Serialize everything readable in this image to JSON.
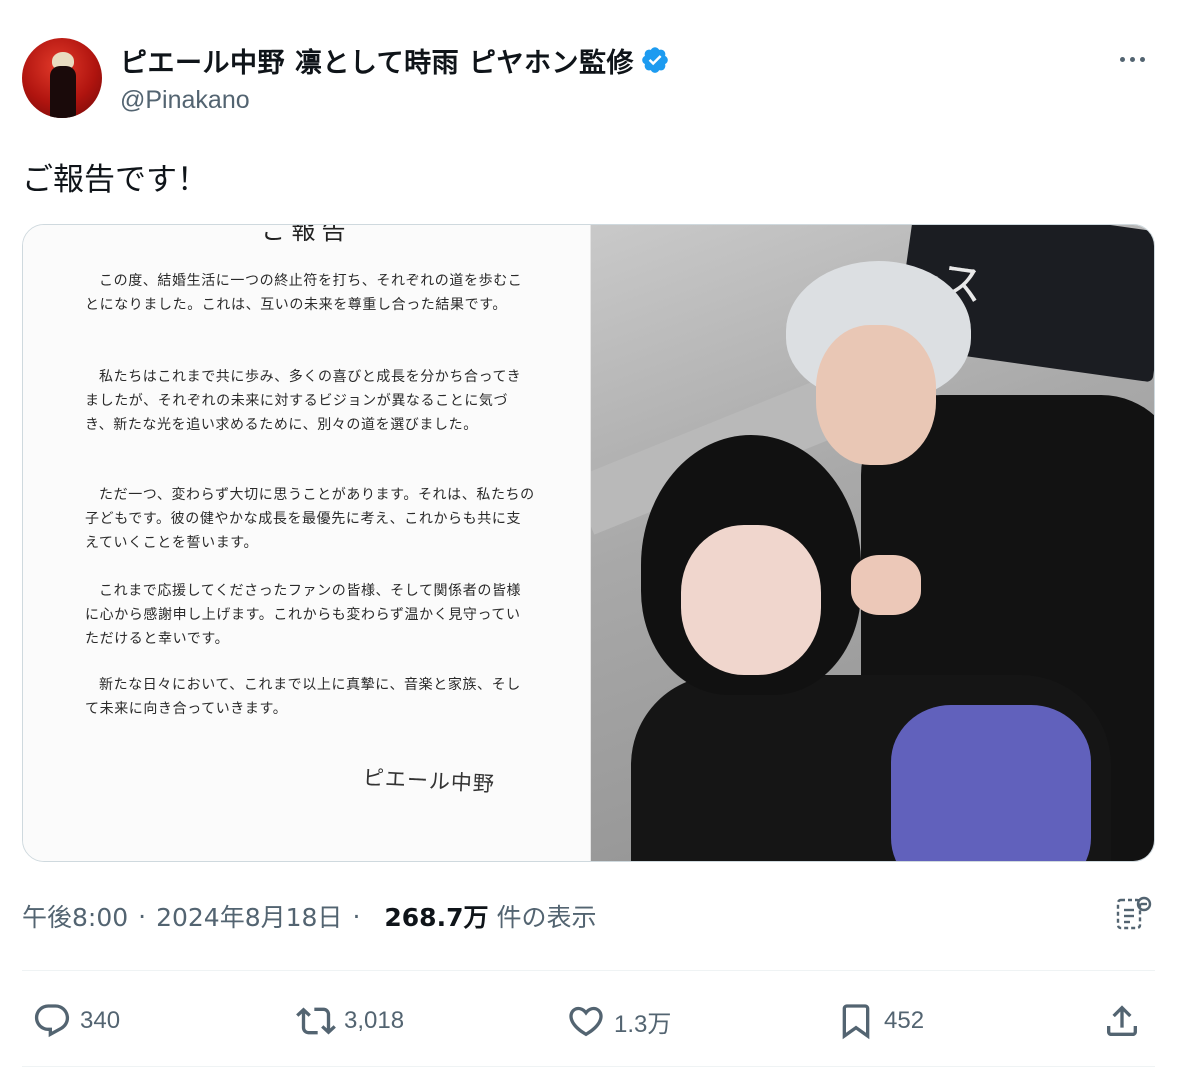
{
  "user": {
    "display_name": "ピエール中野 凛として時雨 ピヤホン監修",
    "handle": "@Pinakano",
    "verified": true,
    "verified_color": "#1d9bf0"
  },
  "tweet": {
    "text": "ご報告です！"
  },
  "media": {
    "document": {
      "title": "ご報告",
      "paragraphs": [
        "この度、結婚生活に一つの終止符を打ち、それぞれの道を歩むことになりました。これは、互いの未来を尊重し合った結果です。",
        "私たちはこれまで共に歩み、多くの喜びと成長を分かち合ってきましたが、それぞれの未来に対するビジョンが異なることに気づき、新たな光を追い求めるために、別々の道を選びました。",
        "ただ一つ、変わらず大切に思うことがあります。それは、私たちの子どもです。彼の健やかな成長を最優先に考え、これからも共に支えていくことを誓います。",
        "これまで応援してくださったファンの皆様、そして関係者の皆様に心から感謝申し上げます。これからも変わらず温かく見守っていただけると幸いです。",
        "新たな日々において、これまで以上に真摯に、音楽と家族、そして未来に向き合っていきます。"
      ],
      "signature": "ピエール中野"
    },
    "photo": {
      "sign_text": "ース"
    }
  },
  "meta": {
    "time": "午後8:00",
    "separator": "·",
    "date": "2024年8月18日",
    "views": "268.7万",
    "views_label": "件の表示"
  },
  "actions": {
    "replies": "340",
    "reposts": "3,018",
    "likes": "1.3万",
    "bookmarks": "452"
  },
  "icons": [
    "more-icon",
    "verified-icon",
    "analytics-icon",
    "reply-icon",
    "repost-icon",
    "like-icon",
    "bookmark-icon",
    "share-icon"
  ]
}
